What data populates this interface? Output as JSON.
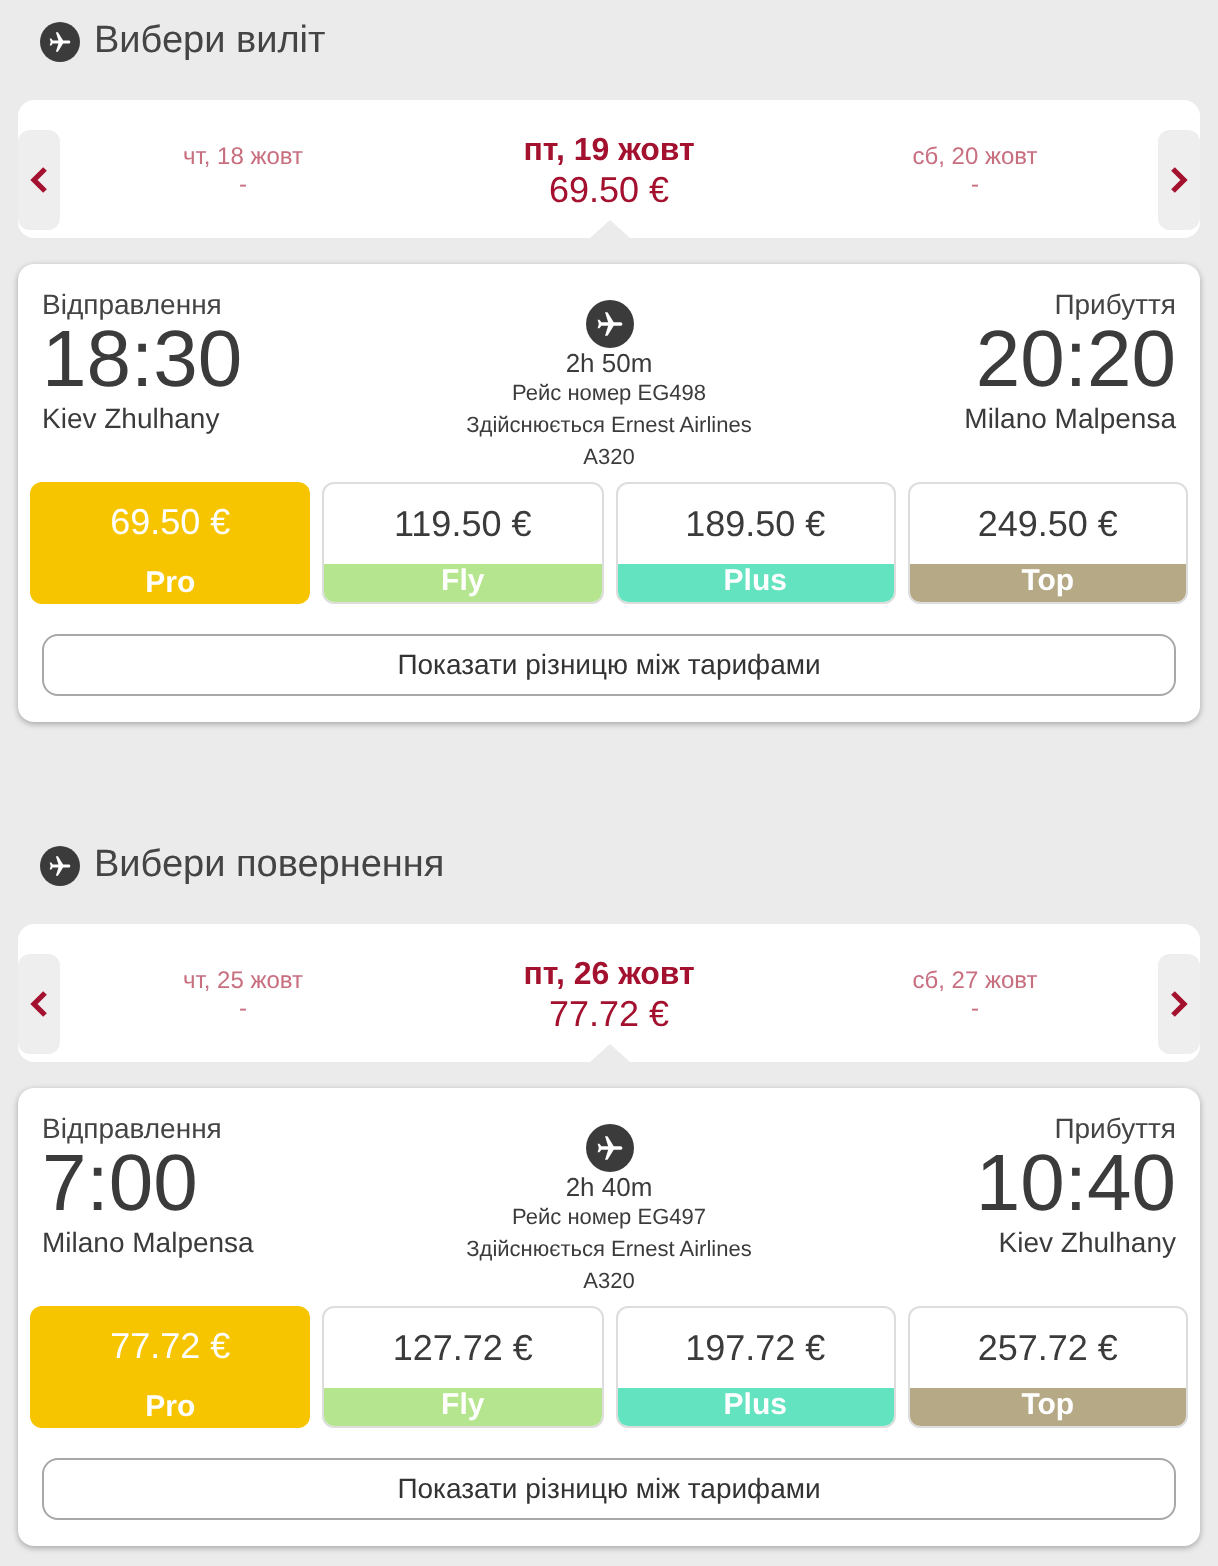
{
  "sections": [
    {
      "title": "Вибери виліт",
      "dates": [
        {
          "day": "чт, 18 жовт",
          "price": "-",
          "selected": false
        },
        {
          "day": "пт, 19 жовт",
          "price": "69.50 €",
          "selected": true
        },
        {
          "day": "сб, 20 жовт",
          "price": "-",
          "selected": false
        }
      ],
      "flight": {
        "departure": {
          "label": "Відправлення",
          "time": "18:30",
          "airport": "Kiev Zhulhany"
        },
        "duration": "2h 50m",
        "flight_number": "Рейс номер EG498",
        "operated_by": "Здійснюється Ernest Airlines",
        "aircraft": "A320",
        "arrival": {
          "label": "Прибуття",
          "time": "20:20",
          "airport": "Milano Malpensa"
        }
      },
      "fares": [
        {
          "price": "69.50 €",
          "name": "Pro",
          "color": "#f6c500",
          "selected": true
        },
        {
          "price": "119.50 €",
          "name": "Fly",
          "color": "#b5e68f",
          "selected": false
        },
        {
          "price": "189.50 €",
          "name": "Plus",
          "color": "#63e3c0",
          "selected": false
        },
        {
          "price": "249.50 €",
          "name": "Top",
          "color": "#b6aa86",
          "selected": false
        }
      ],
      "compare_button": "Показати різницю між тарифами"
    },
    {
      "title": "Вибери повернення",
      "dates": [
        {
          "day": "чт, 25 жовт",
          "price": "-",
          "selected": false
        },
        {
          "day": "пт, 26 жовт",
          "price": "77.72 €",
          "selected": true
        },
        {
          "day": "сб, 27 жовт",
          "price": "-",
          "selected": false
        }
      ],
      "flight": {
        "departure": {
          "label": "Відправлення",
          "time": "7:00",
          "airport": "Milano Malpensa"
        },
        "duration": "2h 40m",
        "flight_number": "Рейс номер EG497",
        "operated_by": "Здійснюється Ernest Airlines",
        "aircraft": "A320",
        "arrival": {
          "label": "Прибуття",
          "time": "10:40",
          "airport": "Kiev Zhulhany"
        }
      },
      "fares": [
        {
          "price": "77.72 €",
          "name": "Pro",
          "color": "#f6c500",
          "selected": true
        },
        {
          "price": "127.72 €",
          "name": "Fly",
          "color": "#b5e68f",
          "selected": false
        },
        {
          "price": "197.72 €",
          "name": "Plus",
          "color": "#63e3c0",
          "selected": false
        },
        {
          "price": "257.72 €",
          "name": "Top",
          "color": "#b6aa86",
          "selected": false
        }
      ],
      "compare_button": "Показати різницю між тарифами"
    }
  ]
}
